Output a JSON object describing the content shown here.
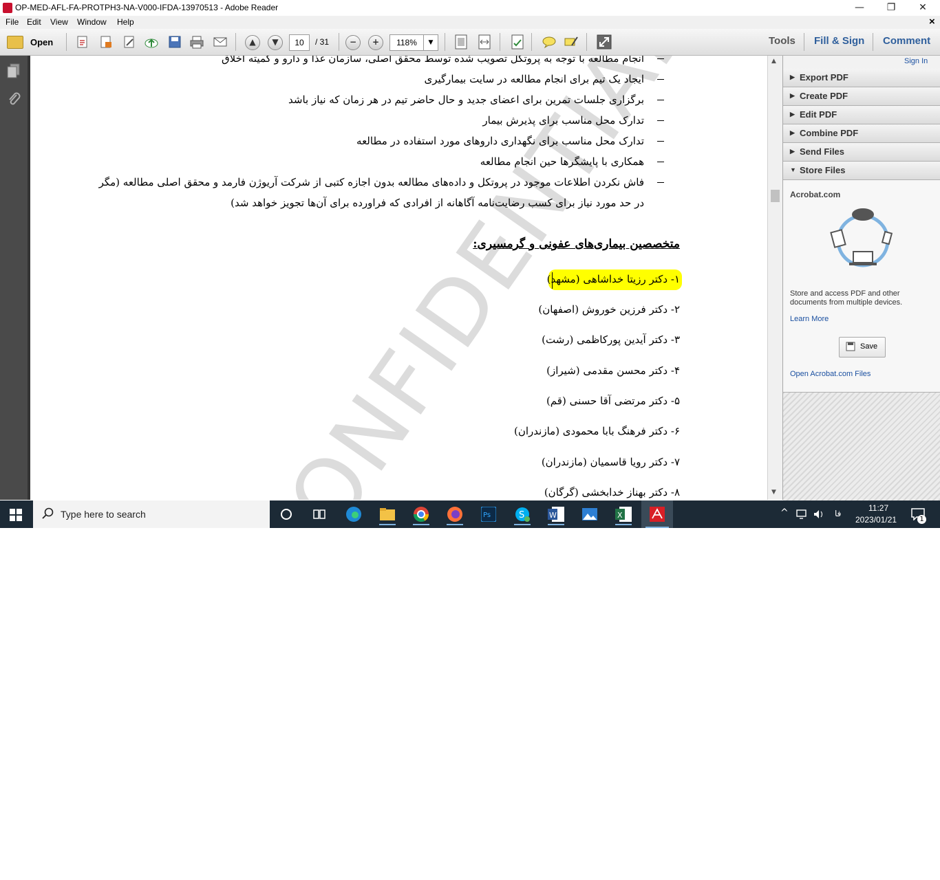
{
  "window": {
    "title": "OP-MED-AFL-FA-PROTPH3-NA-V000-IFDA-13970513 - Adobe Reader",
    "minimize": "—",
    "restore": "❐",
    "close": "✕"
  },
  "menubar": {
    "items": [
      "File",
      "Edit",
      "View",
      "Window",
      "Help"
    ],
    "close": "×"
  },
  "toolbar": {
    "open_label": "Open",
    "page_current": "10",
    "page_total": "/ 31",
    "zoom": "118%",
    "tools": "Tools",
    "fill_sign": "Fill & Sign",
    "comment": "Comment"
  },
  "document": {
    "bullet_lines": [
      "انجام مطالعه با توجه به پروتکل تصویب شده توسط محقق اصلی، سازمان غذا و دارو و کمیته اخلاق",
      "ایجاد یک تیم برای انجام مطالعه در سایت بیمارگیری",
      "برگزاری جلسات تمرین برای اعضای جدید و حال حاضر تیم در هر زمان که نیاز باشد",
      "تدارک محل مناسب برای پذیرش بیمار",
      "تدارک محل مناسب برای نگهداری داروهای مورد استفاده در مطالعه",
      "همکاری با پایشگرها حین انجام مطالعه",
      "فاش نکردن اطلاعات موجود در پروتکل و داده‌های مطالعه بدون اجازه کتبی از شرکت آریوژن فارمد و محقق اصلی مطالعه (مگر"
    ],
    "continuation": "در حد مورد نیاز برای کسب رضایت‌نامه آگاهانه از افرادی که فراورده برای آن‌ها تجویز خواهد شد)",
    "heading": "متخصصین بیماری‌های عفونی و گرمسیری:",
    "doctors": [
      "۱- دکتر رزیتا خداشاهی (مشهد)",
      "۲- دکتر فرزین خوروش (اصفهان)",
      "۳- دکتر آیدین پورکاظمی (رشت)",
      "۴- دکتر محسن مقدمی (شیراز)",
      "۵- دکتر مرتضی آقا حسنی (قم)",
      "۶- دکتر فرهنگ بابا محمودی (مازندران)",
      "۷- دکتر رویا قاسمیان (مازندران)",
      "۸- دکتر بهناز خدابخشی (گرگان)"
    ],
    "watermark": "CONFIDENTIAL",
    "highlight_color": "#ffff00"
  },
  "rightpane": {
    "sign_in": "Sign In",
    "sections": [
      "Export PDF",
      "Create PDF",
      "Edit PDF",
      "Combine PDF",
      "Send Files",
      "Store Files"
    ],
    "acrobat_title": "Acrobat.com",
    "acrobat_desc": "Store and access PDF and other documents from multiple devices.",
    "learn_more": "Learn More",
    "save": "Save",
    "open_files": "Open Acrobat.com Files",
    "link_color": "#1a4fa0"
  },
  "taskbar": {
    "search_placeholder": "Type here to search",
    "time": "11:27",
    "date": "2023/01/21",
    "lang": "فا",
    "notifications": "1",
    "apps": [
      "task-view",
      "edge",
      "file-explorer",
      "chrome",
      "firefox",
      "photoshop",
      "skype",
      "word",
      "photos",
      "excel",
      "acrobat-reader"
    ]
  }
}
